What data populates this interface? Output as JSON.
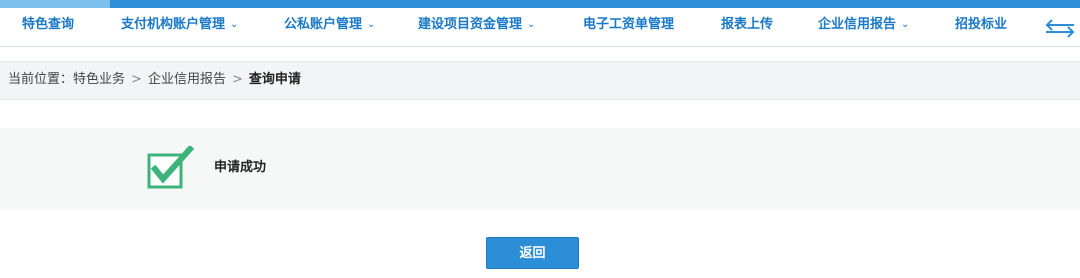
{
  "nav": {
    "items": [
      {
        "label": "特色查询",
        "dropdown": false,
        "active": true
      },
      {
        "label": "支付机构账户管理",
        "dropdown": true
      },
      {
        "label": "公私账户管理",
        "dropdown": true
      },
      {
        "label": "建设项目资金管理",
        "dropdown": true
      },
      {
        "label": "电子工资单管理",
        "dropdown": false
      },
      {
        "label": "报表上传",
        "dropdown": false
      },
      {
        "label": "企业信用报告",
        "dropdown": true
      },
      {
        "label": "招投标业",
        "dropdown": false
      }
    ],
    "chevron": "⌄",
    "swap_icon": "swap-arrows-icon"
  },
  "breadcrumb": {
    "prefix": "当前位置：",
    "items": [
      "特色业务",
      "企业信用报告"
    ],
    "separator": ">",
    "current": "查询申请"
  },
  "result": {
    "icon": "success-check-icon",
    "message": "申请成功"
  },
  "actions": {
    "back_label": "返回"
  },
  "colors": {
    "accent": "#2b8ed6",
    "nav_text": "#1a78c8",
    "success": "#3bb37a"
  }
}
